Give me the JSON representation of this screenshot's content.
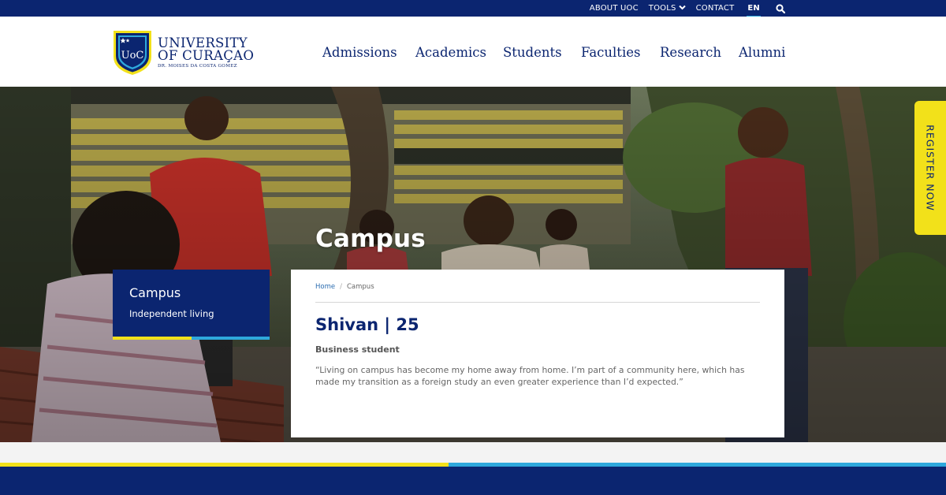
{
  "colors": {
    "navy": "#0b2570",
    "yellow": "#f2e11a",
    "light_blue": "#2ea8dc",
    "white": "#ffffff"
  },
  "topbar": {
    "about": "ABOUT UOC",
    "tools": "TOOLS",
    "contact": "CONTACT",
    "lang": "EN",
    "search_icon": "search-icon"
  },
  "logo": {
    "badge": "UoC",
    "line1": "UNIVERSITY",
    "line2": "OF CURAÇAO",
    "line3": "DR. MOISES DA COSTA GOMEZ"
  },
  "nav": [
    {
      "label": "Admissions"
    },
    {
      "label": "Academics"
    },
    {
      "label": "Students"
    },
    {
      "label": "Faculties"
    },
    {
      "label": "Research"
    },
    {
      "label": "Alumni"
    }
  ],
  "hero": {
    "title": "Campus"
  },
  "register": {
    "label": "REGISTER NOW"
  },
  "sidebar": {
    "title": "Campus",
    "link": "Independent living"
  },
  "breadcrumb": {
    "home": "Home",
    "separator": "/",
    "current": "Campus"
  },
  "card": {
    "heading": "Shivan | 25",
    "subheading": "Business student",
    "quote": "“Living on campus has become my home away from home. I’m part of a community here, which has made my transition as a foreign study an even greater experience than I’d expected.”"
  }
}
